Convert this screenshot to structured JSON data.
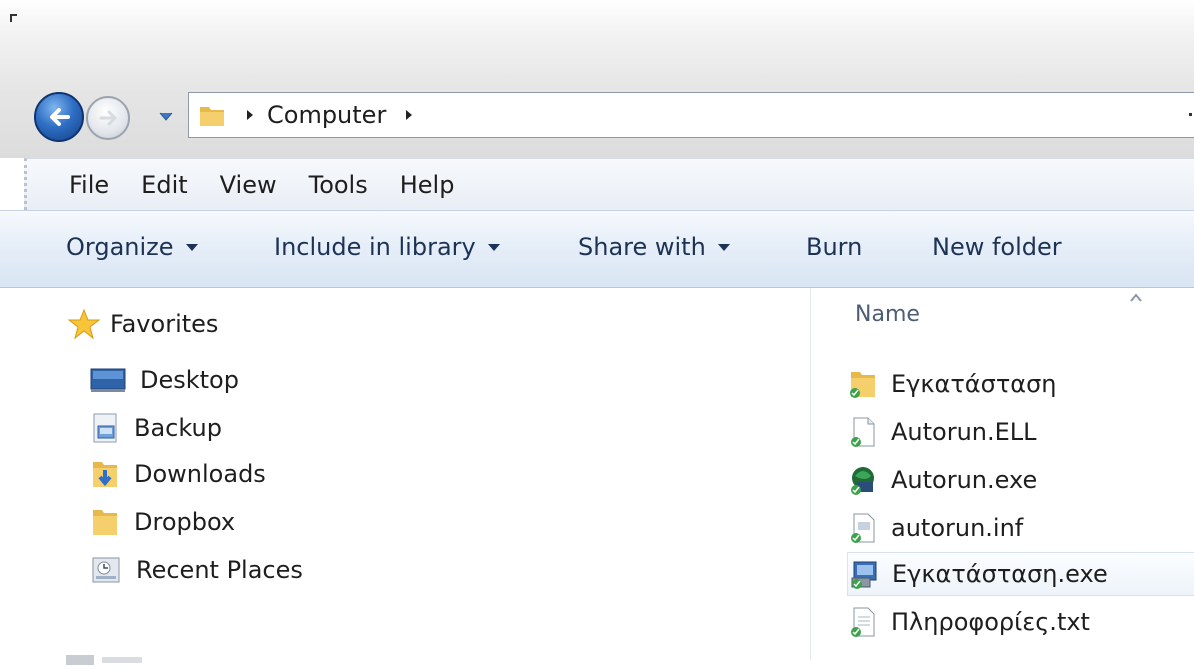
{
  "address": {
    "crumbs": [
      "Computer"
    ]
  },
  "menubar": {
    "items": [
      "File",
      "Edit",
      "View",
      "Tools",
      "Help"
    ]
  },
  "commandbar": {
    "organize": "Organize",
    "include_in_library": "Include in library",
    "share_with": "Share with",
    "burn": "Burn",
    "new_folder": "New folder"
  },
  "navpane": {
    "favorites_label": "Favorites",
    "items": [
      {
        "label": "Desktop",
        "icon": "desktop-icon"
      },
      {
        "label": "Backup",
        "icon": "backup-icon"
      },
      {
        "label": "Downloads",
        "icon": "downloads-folder-icon"
      },
      {
        "label": "Dropbox",
        "icon": "folder-icon"
      },
      {
        "label": "Recent Places",
        "icon": "recent-places-icon"
      }
    ]
  },
  "content": {
    "column_name": "Name",
    "files": [
      {
        "name": "Εγκατάσταση",
        "icon": "folder-icon"
      },
      {
        "name": "Autorun.ELL",
        "icon": "file-icon"
      },
      {
        "name": "Autorun.exe",
        "icon": "app-icon"
      },
      {
        "name": "autorun.inf",
        "icon": "settings-file-icon"
      },
      {
        "name": "Εγκατάσταση.exe",
        "icon": "installer-icon"
      },
      {
        "name": "Πληροφορίες.txt",
        "icon": "text-file-icon"
      }
    ]
  },
  "colors": {
    "command_text": "#1d3356",
    "header_text": "#4d5d73",
    "accent_blue": "#2f6fc4"
  }
}
